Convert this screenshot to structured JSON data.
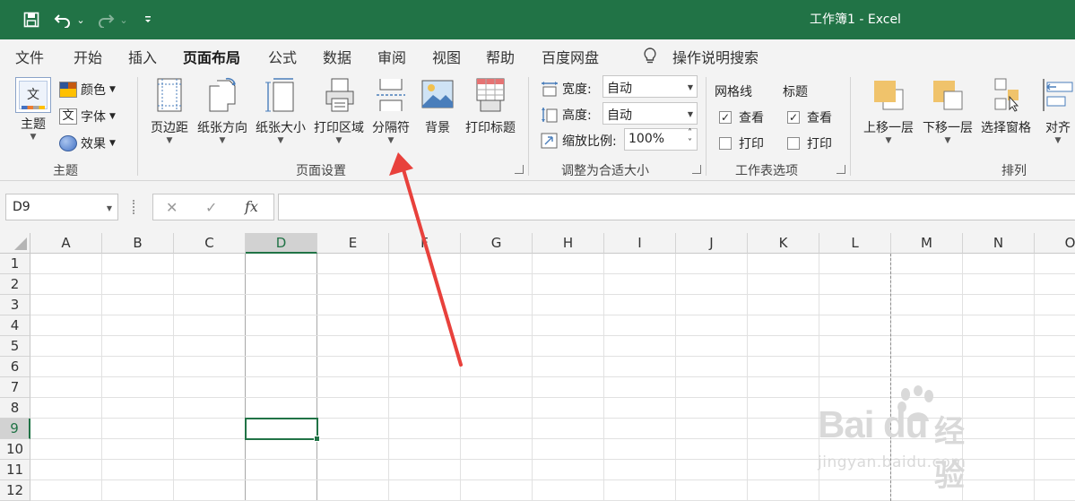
{
  "window": {
    "title": "工作簿1  -  Excel"
  },
  "quick_access": {
    "save_icon": "save-icon",
    "undo_icon": "undo-icon",
    "redo_icon": "redo-icon",
    "customize_icon": "customize-icon",
    "dropdown_glyph": "⌄"
  },
  "tabs": [
    {
      "label": "文件"
    },
    {
      "label": "开始"
    },
    {
      "label": "插入"
    },
    {
      "label": "页面布局",
      "active": true
    },
    {
      "label": "公式"
    },
    {
      "label": "数据"
    },
    {
      "label": "审阅"
    },
    {
      "label": "视图"
    },
    {
      "label": "帮助"
    },
    {
      "label": "百度网盘"
    }
  ],
  "tell_me": {
    "label": "操作说明搜索"
  },
  "ribbon": {
    "themes": {
      "label": "主题",
      "theme_button": "主题",
      "colors": "颜色",
      "fonts": "字体",
      "effects": "效果",
      "font_glyph": "文"
    },
    "page_setup": {
      "label": "页面设置",
      "margins": "页边距",
      "orientation": "纸张方向",
      "size": "纸张大小",
      "print_area": "打印区域",
      "breaks": "分隔符",
      "background": "背景",
      "print_titles": "打印标题"
    },
    "scale_to_fit": {
      "label": "调整为合适大小",
      "width_label": "宽度:",
      "width_value": "自动",
      "height_label": "高度:",
      "height_value": "自动",
      "scale_label": "缩放比例:",
      "scale_value": "100%"
    },
    "sheet_options": {
      "label": "工作表选项",
      "gridlines": "网格线",
      "headings": "标题",
      "view": "查看",
      "print": "打印",
      "gridlines_view_checked": true,
      "gridlines_print_checked": false,
      "headings_view_checked": true,
      "headings_print_checked": false
    },
    "arrange": {
      "label": "排列",
      "bring_forward": "上移一层",
      "send_backward": "下移一层",
      "selection_pane": "选择窗格",
      "align": "对齐"
    }
  },
  "formula_bar": {
    "name_box": "D9",
    "fx_label": "fx",
    "cancel_glyph": "✕",
    "enter_glyph": "✓",
    "formula": ""
  },
  "grid": {
    "columns": [
      "A",
      "B",
      "C",
      "D",
      "E",
      "F",
      "G",
      "H",
      "I",
      "J",
      "K",
      "L",
      "M",
      "N",
      "O"
    ],
    "rows": [
      "1",
      "2",
      "3",
      "4",
      "5",
      "6",
      "7",
      "8",
      "9",
      "10",
      "11",
      "12"
    ],
    "selected_cell": "D9",
    "selected_column": "D",
    "selected_row": "9"
  },
  "watermark": {
    "brand": "Bai du",
    "brand_cn": "经验",
    "url": "jingyan.baidu.com"
  },
  "colors": {
    "accent": "#217346",
    "annotation_arrow": "#e8413c"
  }
}
